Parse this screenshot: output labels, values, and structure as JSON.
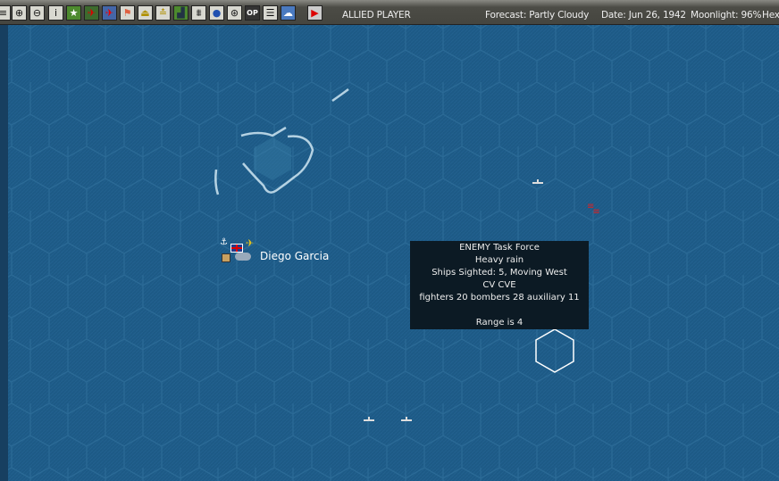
{
  "toolbar": {
    "icons": [
      "list-icon",
      "group-icon",
      "ship-group-icon",
      "info-icon",
      "star-icon",
      "air-red-icon",
      "air-blue-icon",
      "flag-icon",
      "ship-yellow-icon",
      "sub-icon",
      "industry-icon",
      "base-icon",
      "globe-icon",
      "target-icon",
      "op-icon",
      "report-icon",
      "weather-icon"
    ],
    "op_label": "OP",
    "info_label": "i",
    "player": "ALLIED PLAYER",
    "forecast": "Forecast: Partly Cloudy",
    "date": "Date: Jun 26, 1942",
    "moonlight": "Moonlight: 96%",
    "hex": "Hex"
  },
  "map": {
    "base_name": "Diego Garcia"
  },
  "tooltip": {
    "lines": [
      "ENEMY Task Force",
      "Heavy rain",
      "Ships Sighted: 5, Moving West",
      "CV CVE",
      "fighters 20  bombers 28  auxiliary 11",
      "",
      "Range is 4"
    ]
  },
  "colors": {
    "sea": "#1d5a86",
    "hex_line": "#2c6c98",
    "tooltip_bg": "#0c1a24"
  }
}
